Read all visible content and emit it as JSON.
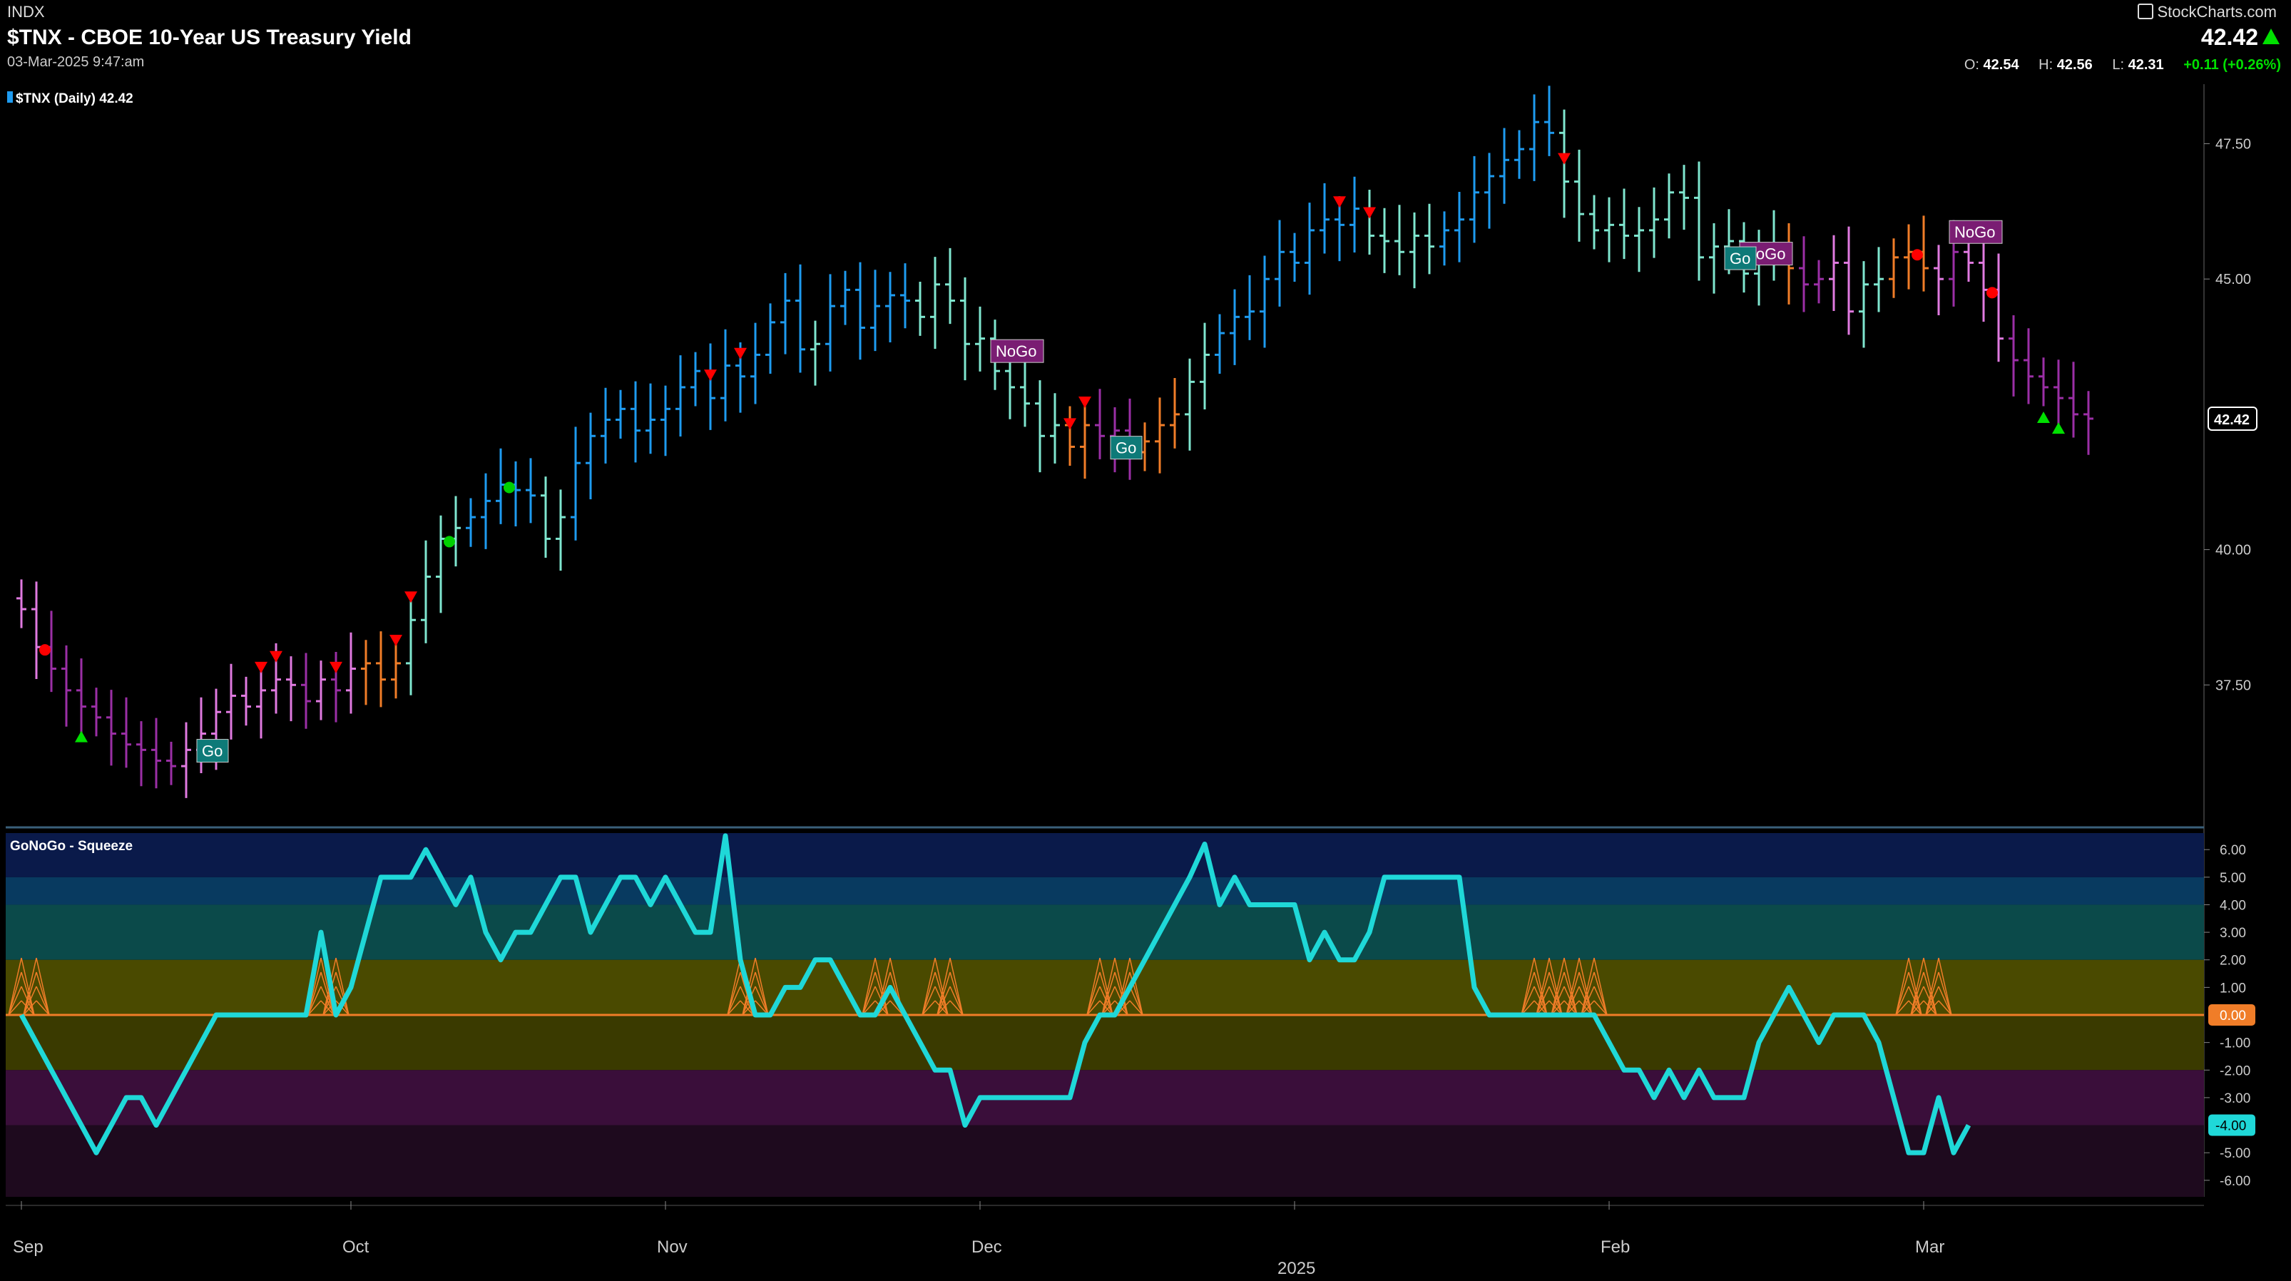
{
  "header": {
    "symbol_code": "INDX",
    "title": "$TNX - CBOE 10-Year US Treasury Yield",
    "date": "03-Mar-2025 9:47:am",
    "brand": "StockCharts.com",
    "last": "42.42",
    "ohlc": {
      "o_label": "O:",
      "o": "42.54",
      "h_label": "H:",
      "h": "42.56",
      "l_label": "L:",
      "l": "42.31",
      "change": "+0.11 (+0.26%)"
    }
  },
  "colors": {
    "background": "#000000",
    "go_strong": "#1e9bf0",
    "go_weak": "#7fe6cf",
    "nogo_strong": "#9b2fa6",
    "nogo_weak": "#e07ae0",
    "neutral": "#f07d28",
    "oscillator": "#1fd8d8",
    "zero_line": "#f07d28",
    "up_triangle": "#00e000",
    "down_triangle": "#ff0000"
  },
  "chart_data": [
    {
      "type": "bar",
      "title": "$TNX (Daily) 42.42",
      "legend": "$TNX (Daily) 42.42",
      "ylim": [
        35.0,
        48.6
      ],
      "y_ticks": [
        "47.50",
        "45.00",
        "40.00",
        "37.50"
      ],
      "y_tick_values": [
        47.5,
        45.0,
        40.0,
        37.5
      ],
      "last_label": "42.42",
      "x_labels": [
        "Sep",
        "Oct",
        "Nov",
        "Dec",
        "Feb",
        "Mar"
      ],
      "year_label": "2025",
      "note": "close values per trading day (approx.)",
      "closes": [
        38.9,
        38.2,
        37.8,
        37.4,
        37.1,
        36.9,
        36.6,
        36.4,
        36.3,
        36.1,
        36.0,
        36.3,
        36.6,
        37.0,
        37.3,
        37.1,
        37.4,
        37.6,
        37.5,
        37.2,
        37.6,
        37.4,
        37.8,
        37.9,
        37.6,
        37.9,
        38.7,
        39.5,
        40.2,
        40.4,
        40.6,
        40.9,
        41.2,
        41.1,
        41.0,
        40.2,
        40.6,
        41.6,
        42.1,
        42.4,
        42.6,
        42.2,
        42.4,
        42.6,
        43.0,
        43.3,
        42.8,
        43.4,
        43.2,
        43.6,
        44.2,
        44.6,
        43.7,
        43.8,
        44.5,
        44.8,
        44.1,
        44.5,
        44.7,
        44.6,
        44.3,
        44.9,
        44.6,
        43.8,
        43.9,
        43.3,
        43.0,
        42.7,
        42.1,
        42.3,
        41.9,
        42.3,
        42.1,
        42.2,
        41.8,
        42.0,
        42.3,
        42.5,
        43.1,
        43.6,
        44.0,
        44.3,
        44.4,
        45.0,
        45.5,
        45.3,
        45.9,
        46.1,
        46.0,
        46.3,
        45.8,
        45.7,
        45.5,
        45.8,
        45.6,
        45.9,
        46.1,
        46.6,
        46.9,
        47.2,
        47.4,
        47.9,
        47.7,
        46.8,
        46.2,
        45.9,
        46.0,
        45.8,
        45.9,
        46.1,
        46.6,
        46.5,
        45.4,
        45.6,
        45.7,
        45.1,
        45.4,
        45.6,
        45.2,
        44.9,
        45.0,
        45.3,
        44.4,
        44.9,
        45.0,
        45.4,
        45.5,
        45.2,
        45.0,
        45.5,
        45.3,
        44.8,
        43.9,
        43.5,
        43.2,
        43.0,
        42.8,
        42.5,
        42.42
      ],
      "bar_colors": [
        "nogo_weak",
        "nogo_weak",
        "nogo_strong",
        "nogo_strong",
        "nogo_strong",
        "nogo_strong",
        "nogo_strong",
        "nogo_strong",
        "nogo_strong",
        "nogo_strong",
        "nogo_strong",
        "nogo_weak",
        "nogo_weak",
        "nogo_weak",
        "nogo_weak",
        "nogo_weak",
        "nogo_weak",
        "nogo_weak",
        "nogo_weak",
        "nogo_strong",
        "nogo_weak",
        "nogo_strong",
        "nogo_weak",
        "neutral",
        "neutral",
        "neutral",
        "go_weak",
        "go_weak",
        "go_weak",
        "go_weak",
        "go_strong",
        "go_strong",
        "go_strong",
        "go_strong",
        "go_strong",
        "go_weak",
        "go_weak",
        "go_strong",
        "go_strong",
        "go_strong",
        "go_strong",
        "go_strong",
        "go_strong",
        "go_strong",
        "go_strong",
        "go_strong",
        "go_strong",
        "go_strong",
        "go_strong",
        "go_strong",
        "go_strong",
        "go_strong",
        "go_strong",
        "go_weak",
        "go_strong",
        "go_strong",
        "go_strong",
        "go_strong",
        "go_strong",
        "go_strong",
        "go_weak",
        "go_weak",
        "go_weak",
        "go_weak",
        "go_weak",
        "go_weak",
        "go_weak",
        "go_weak",
        "go_weak",
        "go_weak",
        "neutral",
        "neutral",
        "nogo_strong",
        "nogo_strong",
        "nogo_strong",
        "neutral",
        "neutral",
        "neutral",
        "go_weak",
        "go_weak",
        "go_strong",
        "go_strong",
        "go_strong",
        "go_strong",
        "go_strong",
        "go_strong",
        "go_strong",
        "go_strong",
        "go_strong",
        "go_strong",
        "go_weak",
        "go_weak",
        "go_weak",
        "go_weak",
        "go_weak",
        "go_strong",
        "go_strong",
        "go_strong",
        "go_strong",
        "go_strong",
        "go_strong",
        "go_strong",
        "go_strong",
        "go_weak",
        "go_weak",
        "go_weak",
        "go_weak",
        "go_weak",
        "go_weak",
        "go_weak",
        "go_weak",
        "go_weak",
        "go_weak",
        "go_weak",
        "go_weak",
        "go_weak",
        "go_weak",
        "go_weak",
        "neutral",
        "nogo_strong",
        "nogo_strong",
        "nogo_weak",
        "nogo_weak",
        "go_weak",
        "go_weak",
        "neutral",
        "neutral",
        "neutral",
        "nogo_weak",
        "nogo_strong",
        "nogo_weak",
        "nogo_weak",
        "nogo_weak",
        "nogo_strong",
        "nogo_strong",
        "nogo_strong",
        "nogo_strong",
        "nogo_strong",
        "nogo_strong",
        "nogo_strong",
        "nogo_strong"
      ],
      "labels": [
        {
          "text": "Go",
          "kind": "go",
          "day": 12
        },
        {
          "text": "NoGo",
          "kind": "nogo",
          "day": 65
        },
        {
          "text": "Go",
          "kind": "go",
          "day": 73
        },
        {
          "text": "NoGo",
          "kind": "nogo",
          "day": 115
        },
        {
          "text": "Go",
          "kind": "go",
          "day": 114
        },
        {
          "text": "NoGo",
          "kind": "nogo",
          "day": 129
        }
      ]
    },
    {
      "type": "line",
      "title": "GoNoGo - Squeeze",
      "legend": "GoNoGo - Squeeze",
      "ylim": [
        -6.6,
        6.6
      ],
      "y_ticks": [
        "6.00",
        "5.00",
        "4.00",
        "3.00",
        "2.00",
        "1.00",
        "-1.00",
        "-2.00",
        "-3.00",
        "-5.00",
        "-6.00"
      ],
      "y_tick_values": [
        6,
        5,
        4,
        3,
        2,
        1,
        -1,
        -2,
        -3,
        -5,
        -6
      ],
      "zero_label": "0.00",
      "last_label": "-4.00",
      "x_labels": [
        "Sep",
        "Oct",
        "Nov",
        "Dec",
        "Feb",
        "Mar"
      ],
      "year_label": "2025",
      "values": [
        0,
        -1,
        -2,
        -3,
        -4,
        -5,
        -4,
        -3,
        -3,
        -4,
        -3,
        -2,
        -1,
        0,
        0,
        0,
        0,
        0,
        0,
        0,
        3,
        0,
        1,
        3,
        5,
        5,
        5,
        6,
        5,
        4,
        5,
        3,
        2,
        3,
        3,
        4,
        5,
        5,
        3,
        4,
        5,
        5,
        4,
        5,
        4,
        3,
        3,
        6.5,
        2,
        0,
        0,
        1,
        1,
        2,
        2,
        1,
        0,
        0,
        1,
        0,
        -1,
        -2,
        -2,
        -4,
        -3,
        -3,
        -3,
        -3,
        -3,
        -3,
        -3,
        -1,
        0,
        0,
        1,
        2,
        3,
        4,
        5,
        6.2,
        4,
        5,
        4,
        4,
        4,
        4,
        2,
        3,
        2,
        2,
        3,
        5,
        5,
        5,
        5,
        5,
        5,
        1,
        0,
        0,
        0,
        0,
        0,
        0,
        0,
        0,
        -1,
        -2,
        -2,
        -3,
        -2,
        -3,
        -2,
        -3,
        -3,
        -3,
        -1,
        0,
        1,
        0,
        -1,
        0,
        0,
        0,
        -1,
        -3,
        -5,
        -5,
        -3,
        -5,
        -4
      ],
      "squeeze_days": [
        0,
        1,
        20,
        21,
        48,
        49,
        57,
        58,
        61,
        62,
        72,
        73,
        74,
        101,
        102,
        103,
        104,
        105,
        126,
        127,
        128
      ]
    }
  ]
}
